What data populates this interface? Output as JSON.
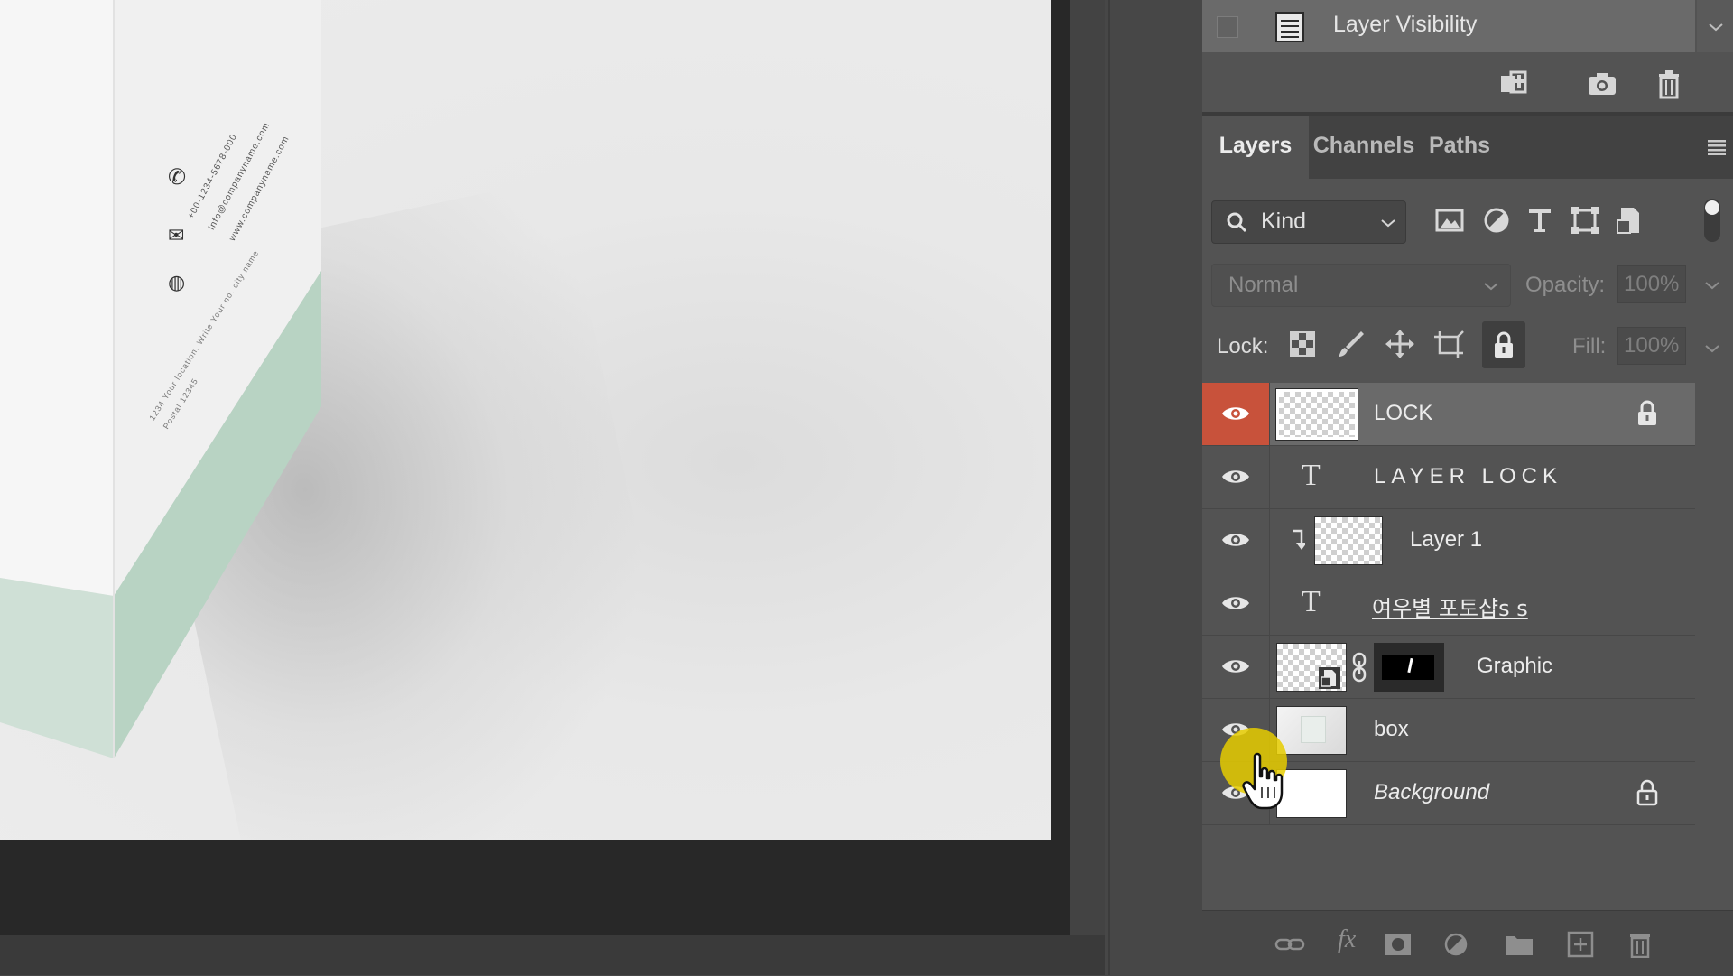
{
  "colors": {
    "panel_bg": "#535353",
    "selected_row": "#6a6a6a",
    "visibility_highlight": "#c8523b",
    "cursor_highlight": "#e6cd00"
  },
  "history": {
    "item_label": "Layer Visibility",
    "icons": [
      "new-document-from-state-icon",
      "camera-snapshot-icon",
      "trash-icon"
    ]
  },
  "tabs": [
    {
      "label": "Layers",
      "active": true
    },
    {
      "label": "Channels",
      "active": false
    },
    {
      "label": "Paths",
      "active": false
    }
  ],
  "filter": {
    "kind_label": "Kind",
    "icons": [
      "image-filter-icon",
      "adjustment-filter-icon",
      "type-filter-icon",
      "shape-filter-icon",
      "smart-object-filter-icon"
    ]
  },
  "blend": {
    "mode": "Normal",
    "opacity_label": "Opacity:",
    "opacity_value": "100%",
    "fill_label": "Fill:",
    "fill_value": "100%"
  },
  "lock": {
    "label": "Lock:",
    "icons": [
      "lock-transparent-pixels-icon",
      "lock-image-pixels-icon",
      "lock-position-icon",
      "lock-artboard-icon",
      "lock-all-icon"
    ]
  },
  "layers": [
    {
      "name": "LOCK",
      "type": "pixel",
      "selected": true,
      "locked": true
    },
    {
      "name": "LAYER LOCK",
      "type": "text"
    },
    {
      "name": "Layer 1",
      "type": "pixel",
      "clipped": true
    },
    {
      "name": "여우별 포토샵s  s",
      "type": "text"
    },
    {
      "name": "Graphic",
      "type": "smart-object-with-mask"
    },
    {
      "name": "box",
      "type": "pixel"
    },
    {
      "name": "Background",
      "type": "background",
      "locked": true
    }
  ],
  "footer": {
    "icons": [
      "link-layers-icon",
      "fx-icon",
      "add-mask-icon",
      "adjustment-layer-icon",
      "new-group-icon",
      "new-layer-icon",
      "delete-layer-icon"
    ]
  },
  "document_text": {
    "contact_lines": [
      "+00-1234-5678-000",
      "info@companyname.com",
      "www.companyname.com"
    ],
    "address_lines": [
      "1234 Your location, Write Your no. city name",
      "Postal 12345"
    ]
  }
}
